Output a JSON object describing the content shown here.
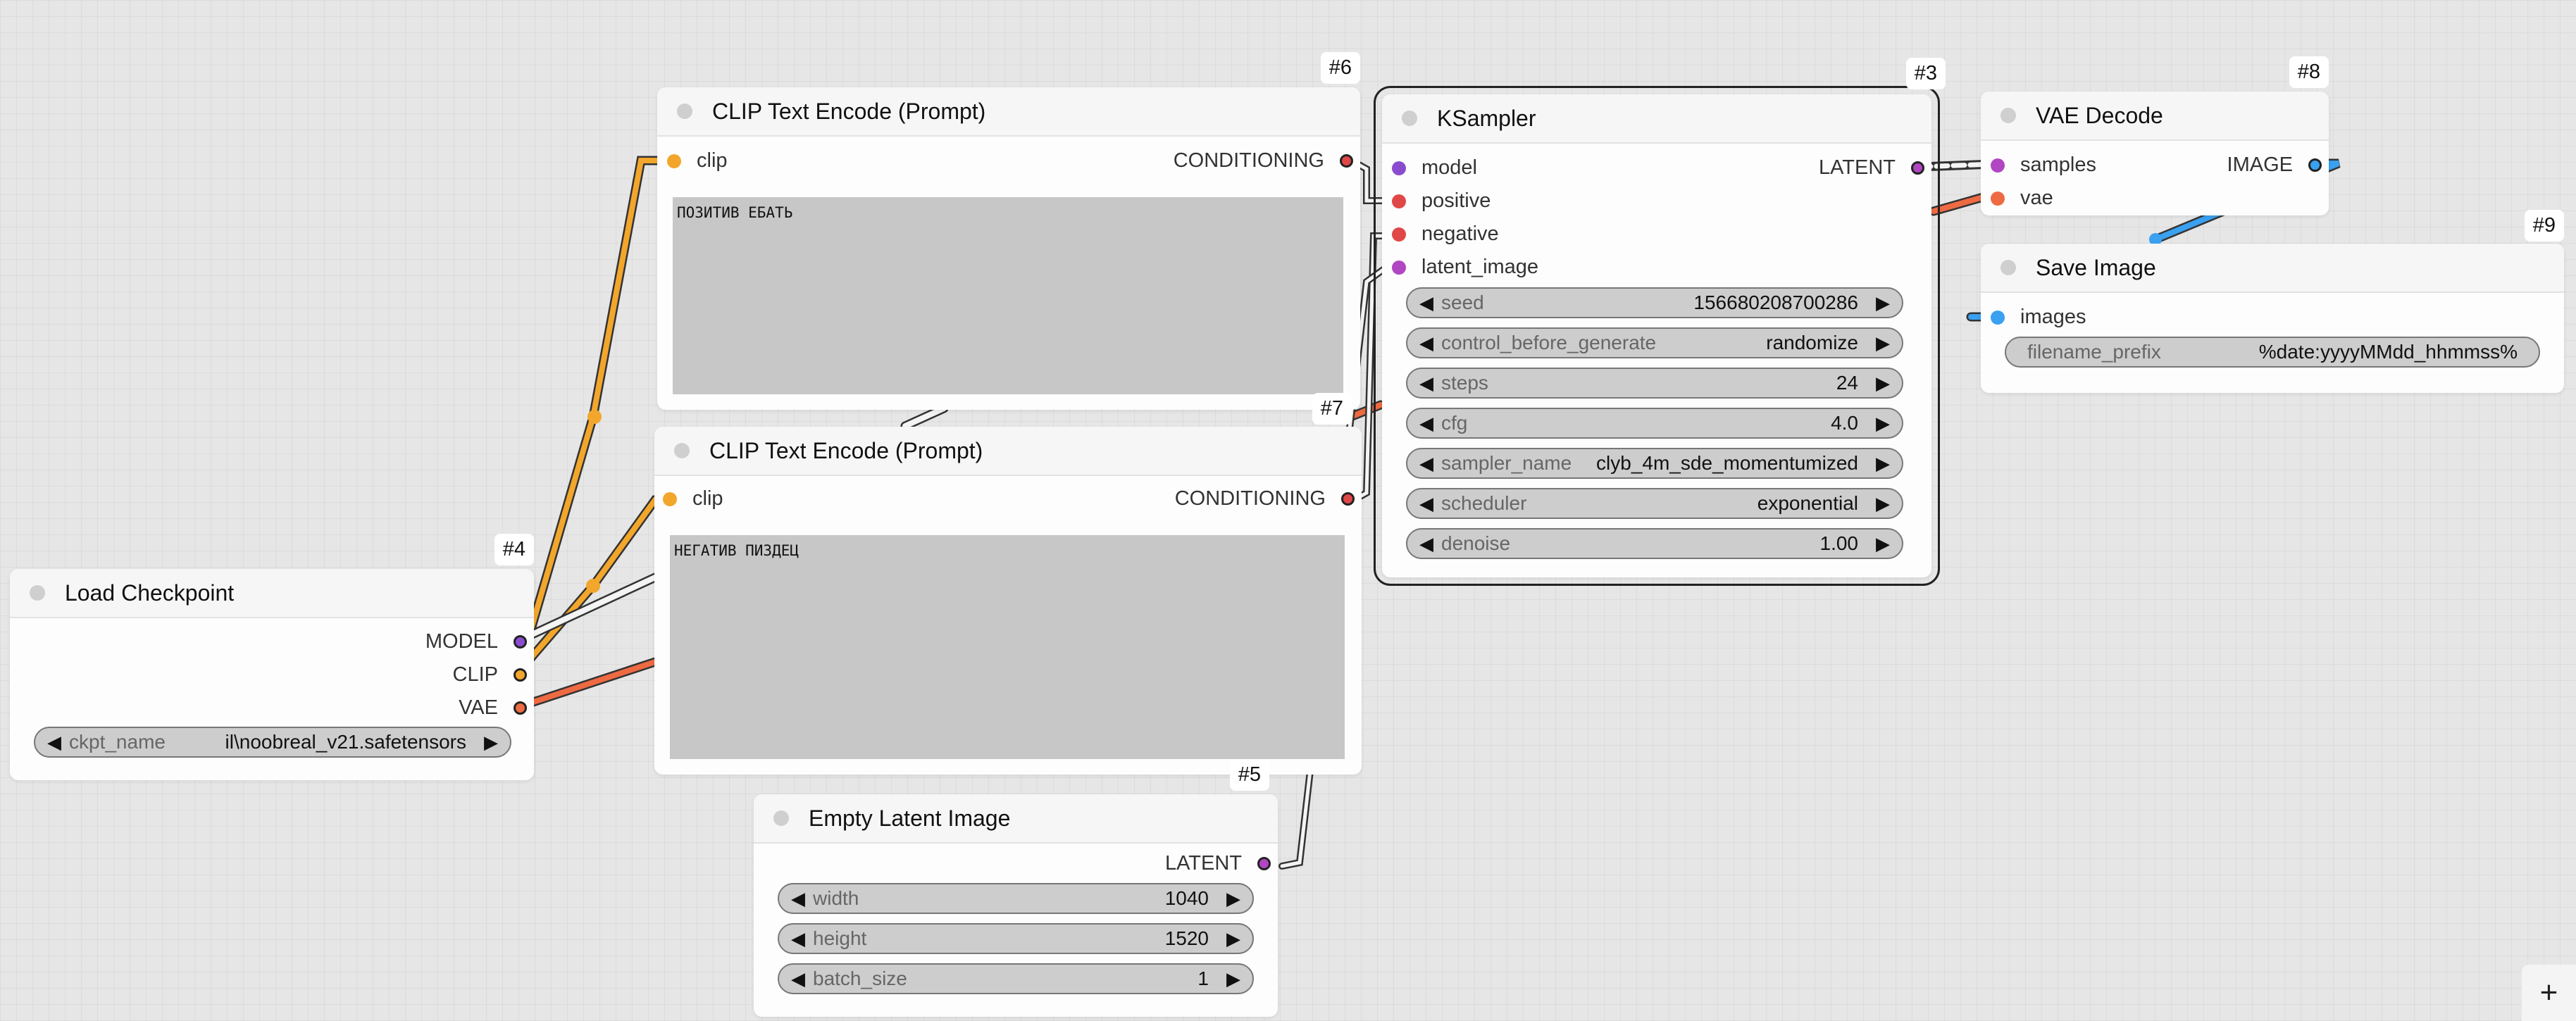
{
  "colors": {
    "model": "#8a4ccf",
    "clip": "#f2a62b",
    "vae": "#ee6a42",
    "conditioning": "#e04747",
    "latent": "#b146c2",
    "image": "#3aa0f0"
  },
  "nodes": {
    "load_checkpoint": {
      "id": "#4",
      "title": "Load Checkpoint",
      "outputs": [
        "MODEL",
        "CLIP",
        "VAE"
      ],
      "ckpt_label": "ckpt_name",
      "ckpt_value": "il\\noobreal_v21.safetensors"
    },
    "clip_pos": {
      "id": "#6",
      "title": "CLIP Text Encode (Prompt)",
      "input": "clip",
      "output": "CONDITIONING",
      "text": "ПОЗИТИВ ЕБАТЬ"
    },
    "clip_neg": {
      "id": "#7",
      "title": "CLIP Text Encode (Prompt)",
      "input": "clip",
      "output": "CONDITIONING",
      "text": "НЕГАТИВ ПИЗДЕЦ"
    },
    "empty_latent": {
      "id": "#5",
      "title": "Empty Latent Image",
      "output": "LATENT",
      "widgets": [
        {
          "label": "width",
          "value": "1040"
        },
        {
          "label": "height",
          "value": "1520"
        },
        {
          "label": "batch_size",
          "value": "1"
        }
      ]
    },
    "ksampler": {
      "id": "#3",
      "title": "KSampler",
      "inputs": [
        "model",
        "positive",
        "negative",
        "latent_image"
      ],
      "output": "LATENT",
      "widgets": [
        {
          "label": "seed",
          "value": "156680208700286"
        },
        {
          "label": "control_before_generate",
          "value": "randomize"
        },
        {
          "label": "steps",
          "value": "24"
        },
        {
          "label": "cfg",
          "value": "4.0"
        },
        {
          "label": "sampler_name",
          "value": "clyb_4m_sde_momentumized"
        },
        {
          "label": "scheduler",
          "value": "exponential"
        },
        {
          "label": "denoise",
          "value": "1.00"
        }
      ]
    },
    "vae_decode": {
      "id": "#8",
      "title": "VAE Decode",
      "inputs": [
        "samples",
        "vae"
      ],
      "output": "IMAGE"
    },
    "save_image": {
      "id": "#9",
      "title": "Save Image",
      "input": "images",
      "prefix_label": "filename_prefix",
      "prefix_value": "%date:yyyyMMdd_hhmmss%"
    }
  },
  "toolbar": {
    "add_label": "+"
  }
}
